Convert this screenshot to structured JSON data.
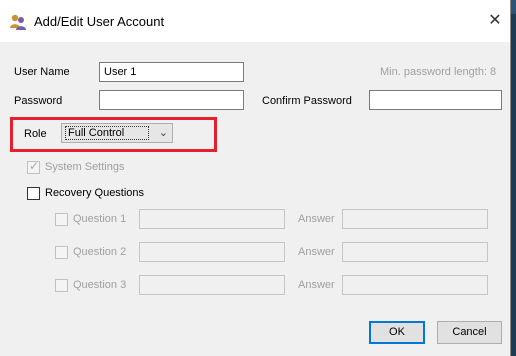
{
  "window": {
    "title": "Add/Edit User Account",
    "close_glyph": "✕"
  },
  "form": {
    "user_name_label": "User Name",
    "user_name_value": "User 1",
    "min_password_hint": "Min. password length: 8",
    "password_label": "Password",
    "password_value": "",
    "confirm_password_label": "Confirm Password",
    "confirm_password_value": "",
    "role_label": "Role",
    "role_selected": "Full Control"
  },
  "checks": {
    "system_settings_label": "System Settings",
    "system_settings_checked": true,
    "recovery_questions_label": "Recovery Questions",
    "recovery_questions_checked": false
  },
  "recovery": {
    "answer_label": "Answer",
    "questions": [
      {
        "label": "Question 1"
      },
      {
        "label": "Question 2"
      },
      {
        "label": "Question 3"
      }
    ]
  },
  "buttons": {
    "ok": "OK",
    "cancel": "Cancel"
  },
  "colors": {
    "highlight": "#e4202e",
    "default_button_border": "#0078d7"
  }
}
